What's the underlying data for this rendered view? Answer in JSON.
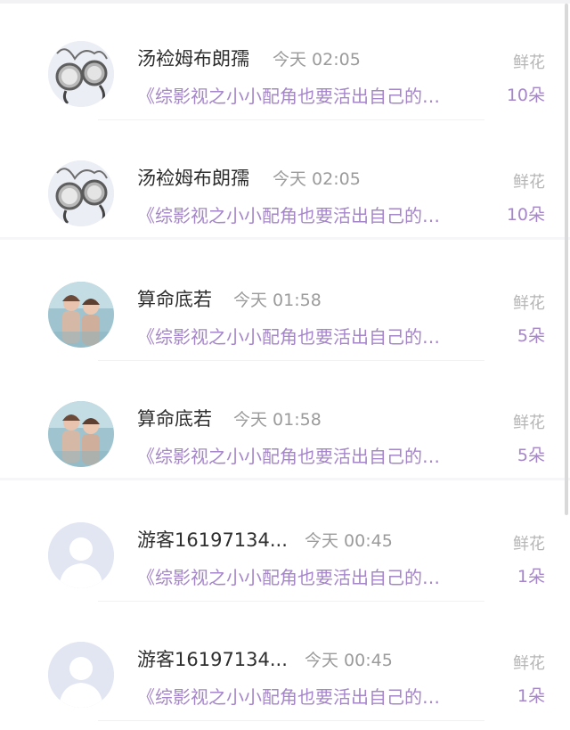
{
  "list": {
    "items": [
      {
        "name": "汤裣姆布朗孺",
        "time": "今天 02:05",
        "book": "《综影视之小小配角也要活出自己的…",
        "gift_label": "鲜花",
        "gift_count": "10朵",
        "avatar_icon": "pocket-watch-avatar"
      },
      {
        "name": "汤裣姆布朗孺",
        "time": "今天 02:05",
        "book": "《综影视之小小配角也要活出自己的…",
        "gift_label": "鲜花",
        "gift_count": "10朵",
        "avatar_icon": "pocket-watch-avatar"
      },
      {
        "name": "算命底若",
        "time": "今天 01:58",
        "book": "《综影视之小小配角也要活出自己的…",
        "gift_label": "鲜花",
        "gift_count": "5朵",
        "avatar_icon": "two-girls-photo-avatar"
      },
      {
        "name": "算命底若",
        "time": "今天 01:58",
        "book": "《综影视之小小配角也要活出自己的…",
        "gift_label": "鲜花",
        "gift_count": "5朵",
        "avatar_icon": "two-girls-photo-avatar"
      },
      {
        "name": "游客16197134...",
        "time": "今天 00:45",
        "book": "《综影视之小小配角也要活出自己的…",
        "gift_label": "鲜花",
        "gift_count": "1朵",
        "avatar_icon": "default-user-avatar"
      },
      {
        "name": "游客16197134...",
        "time": "今天 00:45",
        "book": "《综影视之小小配角也要活出自己的…",
        "gift_label": "鲜花",
        "gift_count": "1朵",
        "avatar_icon": "default-user-avatar"
      }
    ]
  },
  "colors": {
    "accent": "#a586c9",
    "name_text": "#2e2e2e",
    "meta_text": "#9b9b9b",
    "default_avatar_bg": "#e1e6f2"
  }
}
